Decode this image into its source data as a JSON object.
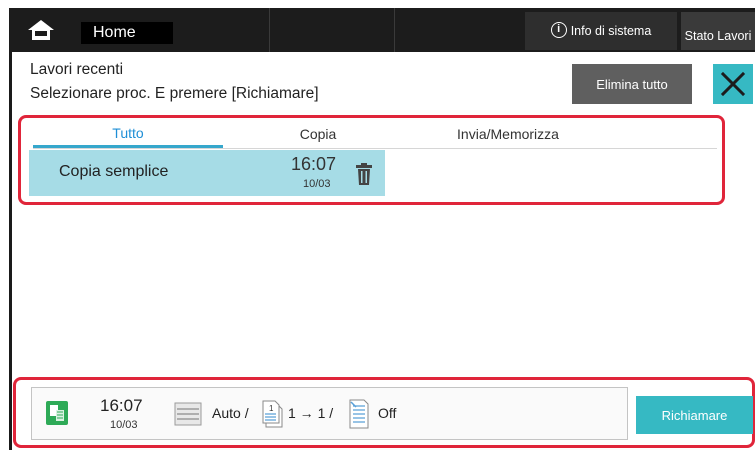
{
  "topbar": {
    "home_label": "Home",
    "system_info_label": "Info di sistema",
    "job_status_label": "Stato Lavori",
    "info_glyph": "i"
  },
  "header": {
    "title": "Lavori recenti",
    "subtitle": "Selezionare proc. E premere [Richiamare]",
    "clear_all_label": "Elimina tutto"
  },
  "tabs": [
    {
      "label": "Tutto",
      "selected": true
    },
    {
      "label": "Copia",
      "selected": false
    },
    {
      "label": "Invia/Memorizza",
      "selected": false
    }
  ],
  "jobs": [
    {
      "name": "Copia semplice",
      "time": "16:07",
      "date": "10/03"
    }
  ],
  "summary": {
    "time": "16:07",
    "date": "10/03",
    "paper": "Auto /",
    "duplex": "1 → 1 /",
    "staple": "Off"
  },
  "recall_label": "Richiamare",
  "colors": {
    "accent": "#36b9c3",
    "selected_row": "#a6dce6",
    "highlight_border": "#e0253a",
    "topbar": "#1c1c1c"
  },
  "icons": {
    "home": "home-icon",
    "close": "close-icon",
    "trash": "trash-icon",
    "copy": "copy-icon",
    "paper": "paper-tray-icon",
    "duplex": "duplex-icon",
    "staple": "staple-icon"
  }
}
